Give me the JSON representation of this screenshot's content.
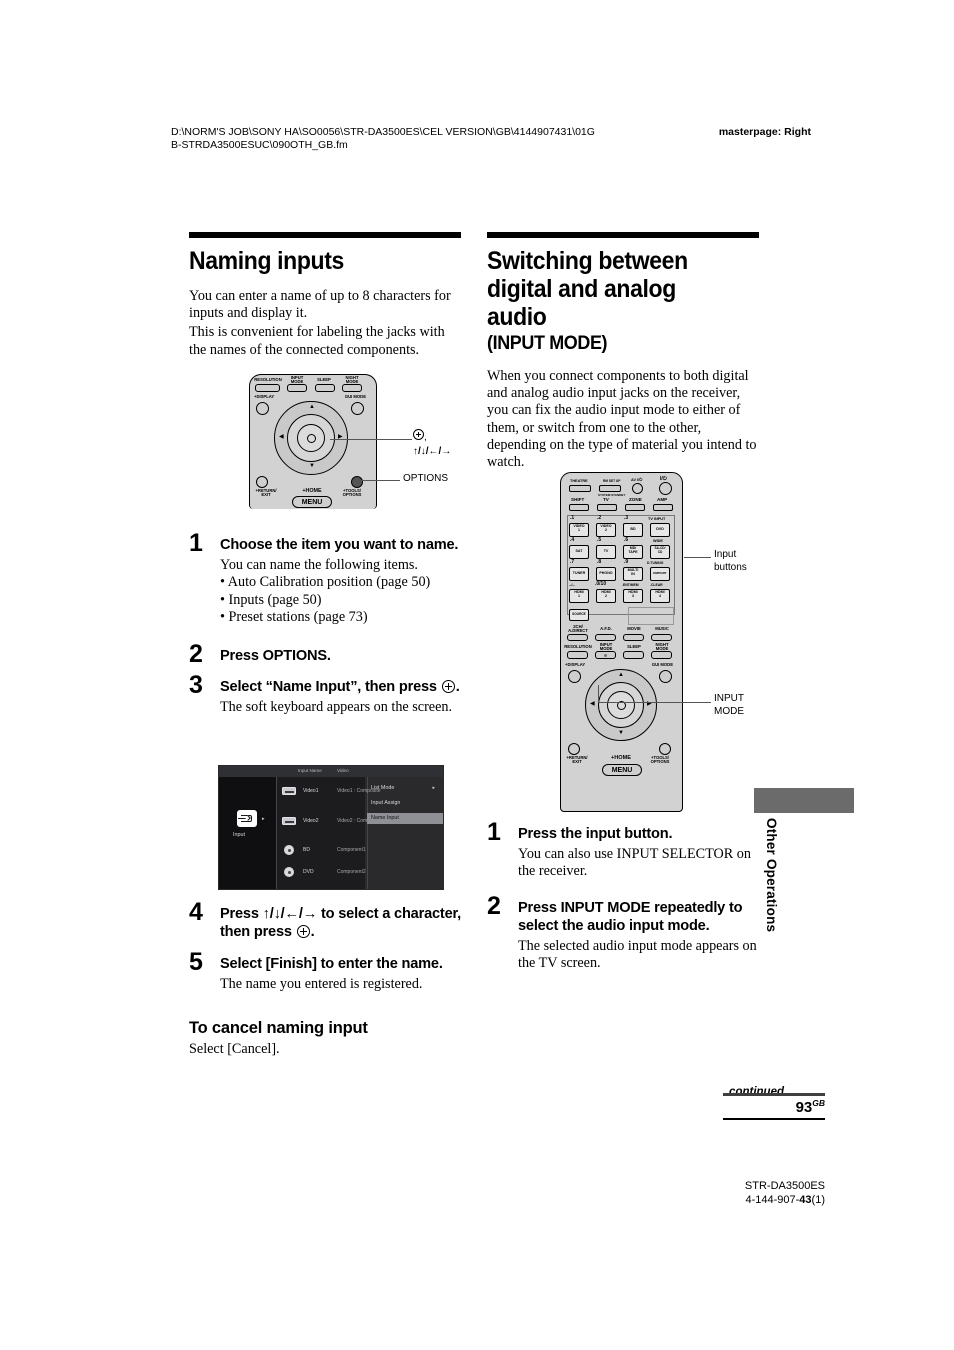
{
  "header": {
    "path": "D:\\NORM'S JOB\\SONY HA\\SO0056\\STR-DA3500ES\\CEL VERSION\\GB\\4144907431\\01GB-STRDA3500ESUC\\090OTH_GB.fm",
    "masterpage": "masterpage: Right"
  },
  "left_column": {
    "title": "Naming inputs",
    "intro_1": "You can enter a name of up to 8 characters for inputs and display it.",
    "intro_2": "This is convenient for labeling the jacks with the names of the connected components.",
    "remote_callouts": {
      "enter_arrows": "↑/↓/←/→",
      "options": "OPTIONS"
    },
    "steps": [
      {
        "num": "1",
        "title": "Choose the item you want to name.",
        "desc": "You can name the following items.",
        "bullets": [
          "• Auto Calibration position (page 50)",
          "• Inputs (page 50)",
          "• Preset stations (page 73)"
        ]
      },
      {
        "num": "2",
        "title": "Press OPTIONS.",
        "desc": "",
        "bullets": []
      },
      {
        "num": "3",
        "title_pre": "Select “Name Input”, then press",
        "title_post": ".",
        "desc": "The soft keyboard appears on the screen.",
        "bullets": []
      },
      {
        "num": "4",
        "title_pre": "Press ↑/↓/←/→ to select a character, then press",
        "title_post": ".",
        "desc": "",
        "bullets": []
      },
      {
        "num": "5",
        "title": "Select [Finish] to enter the name.",
        "desc": "The name you entered is registered.",
        "bullets": []
      }
    ],
    "subhead": "To cancel naming input",
    "subhead_body": "Select [Cancel]."
  },
  "osd": {
    "col_headers": [
      "Input Name",
      "Video"
    ],
    "rows": [
      {
        "name": "Video1",
        "value": "Video1 : Composite"
      },
      {
        "name": "Video2",
        "value": "Video2 : Composite"
      },
      {
        "name": "BD",
        "value": "Component1"
      },
      {
        "name": "DVD",
        "value": "Component2"
      }
    ],
    "sidebar_label": "Input",
    "menu": [
      "List Mode",
      "Input Assign"
    ],
    "menu_selected": "Name Input",
    "menu_arrow": "▸"
  },
  "right_column": {
    "title_line1": "Switching between",
    "title_line2": "digital and analog audio",
    "title_sub": "(INPUT MODE)",
    "intro": "When you connect components to both digital and analog audio input jacks on the receiver, you can fix the audio input mode to either of them, or switch from one to the other, depending on the type of material you intend to watch.",
    "remote_callouts": {
      "input_buttons_l1": "Input",
      "input_buttons_l2": "buttons",
      "input_mode_l1": "INPUT",
      "input_mode_l2": "MODE"
    },
    "steps": [
      {
        "num": "1",
        "title": "Press the input button.",
        "desc": "You can also use INPUT SELECTOR on the receiver."
      },
      {
        "num": "2",
        "title": "Press INPUT MODE repeatedly to select the audio input mode.",
        "desc": "The selected audio input mode appears on the TV screen."
      }
    ]
  },
  "remote_small": {
    "top_row": [
      "RESOLUTION",
      "INPUT\nMODE",
      "SLEEP",
      "NIGHT\nMODE"
    ],
    "display": "+DISPLAY",
    "gui_mode": "GUI MODE",
    "return_exit": "+RETURN/\nEXIT",
    "home": "+HOME",
    "menu": "MENU",
    "tools_options": "+TOOLS/\nOPTIONS"
  },
  "remote_large": {
    "row_power": [
      "THEATRE",
      "RM SET UP",
      "AV I/⏻",
      "I/⏻"
    ],
    "system_standby": "SYSTEM STANDBY",
    "row_mode": [
      "SHIFT",
      "TV",
      "ZONE",
      "AMP"
    ],
    "input_grid": [
      {
        "top": ".1",
        "label": "VIDEO\n1"
      },
      {
        "top": ".2",
        "label": "VIDEO\n2"
      },
      {
        "top": ".3",
        "label": "BD"
      },
      {
        "top": "TV INPUT",
        "label": "DVD"
      },
      {
        "top": ".4",
        "label": "SAT"
      },
      {
        "top": ".5",
        "label": "TV"
      },
      {
        "top": ".6",
        "label": "MD/\nTAPE"
      },
      {
        "top": "WIDE",
        "label": "SA-CD/\nCD"
      },
      {
        "top": ".7",
        "label": "TUNER"
      },
      {
        "top": ".8",
        "label": "PHONO"
      },
      {
        "top": ".9",
        "label": "MULTI\nIN"
      },
      {
        "top": "D.TUNING",
        "label": "DMPORT"
      },
      {
        "top": ".-/--",
        "label": "HDMI\n1"
      },
      {
        "top": ".0/10",
        "label": "HDMI\n2"
      },
      {
        "top": ".ENT/MEM",
        "label": "HDMI\n3"
      },
      {
        "top": ".CLEAR",
        "label": "HDMI\n4"
      }
    ],
    "source": "SOURCE",
    "sound_row1": [
      "2CH/\nA.DIRECT",
      "A.F.D.",
      "MOVIE",
      "MUSIC"
    ],
    "sound_row2": [
      "RESOLUTION",
      "INPUT\nMODE",
      "SLEEP",
      "NIGHT\nMODE"
    ],
    "display": "+DISPLAY",
    "gui_mode": "GUI MODE",
    "return_exit": "+RETURN/\nEXIT",
    "home": "+HOME",
    "menu": "MENU",
    "tools_options": "+TOOLS/\nOPTIONS"
  },
  "side_tab": {
    "label": "Other Operations"
  },
  "footer": {
    "continued": "continued",
    "page": "93",
    "page_sup": "GB",
    "model": "STR-DA3500ES",
    "part_pre": "4-144-907-",
    "part_bold": "43",
    "part_post": "(1)"
  }
}
